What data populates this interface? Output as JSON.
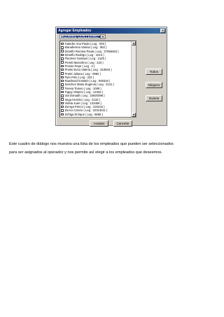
{
  "dialog": {
    "title": "Agregar Empleados",
    "close_label": "x",
    "combo_value": "AGUIRRE GUILLERMO",
    "combo_arrow": "▾",
    "employees": [
      "Galeder Ana Paula ( Leg : 049 )",
      "Manaferena Vanina ( Leg : 952 )",
      "Dimeflo Romina Paula ( Leg : 27058453 )",
      "Dimeflo Rodrigo ( Leg : 1013 )",
      "Fleoresz Gustavo ( Leg : 2125 )",
      "Pereitt Marcelino ( Leg : 223 )",
      "Ponsio Pepe ( Leg : 2 )",
      "Presto Evca Valeria ( Leg : 310944 )",
      "Pretel Juliana ( Leg : 0982 )",
      "Pyto Pelo ( Leg : 222 )",
      "Rawlinoicht Martin ( Leg : 000316 )",
      "Sanchez Maria Eugenia ( Leg : 2121 )",
      "Teresa Tomeo ( Leg : 1009 )",
      "Toppy Vittorini ( Leg : 12332 )",
      "Ula Donadil ( Leg : 22920396 )",
      "Vega Hernán ( Leg : 2133 )",
      "Videla Juan ( Leg : 123456 )",
      "Zuerga Penco ( Leg : 234234 )",
      "Zunco Cancio ( Leg : 22313211 )",
      "Zuñiga Enrique ( Leg : 6666 )"
    ],
    "scroll_up": "▴",
    "scroll_down": "▾",
    "buttons": {
      "todos": "Todos",
      "ninguno": "Ninguno",
      "invierte": "Invierte",
      "aceptar": "Aceptar",
      "cancelar": "Cancelar"
    }
  },
  "caption": {
    "line1": "Este cuadro de diálogo nos muestra una lista de los empleados que pueden ser seleccionados",
    "line2": "para ser asignados al operador y nos permite así elegir a los empleados que deseemos."
  }
}
